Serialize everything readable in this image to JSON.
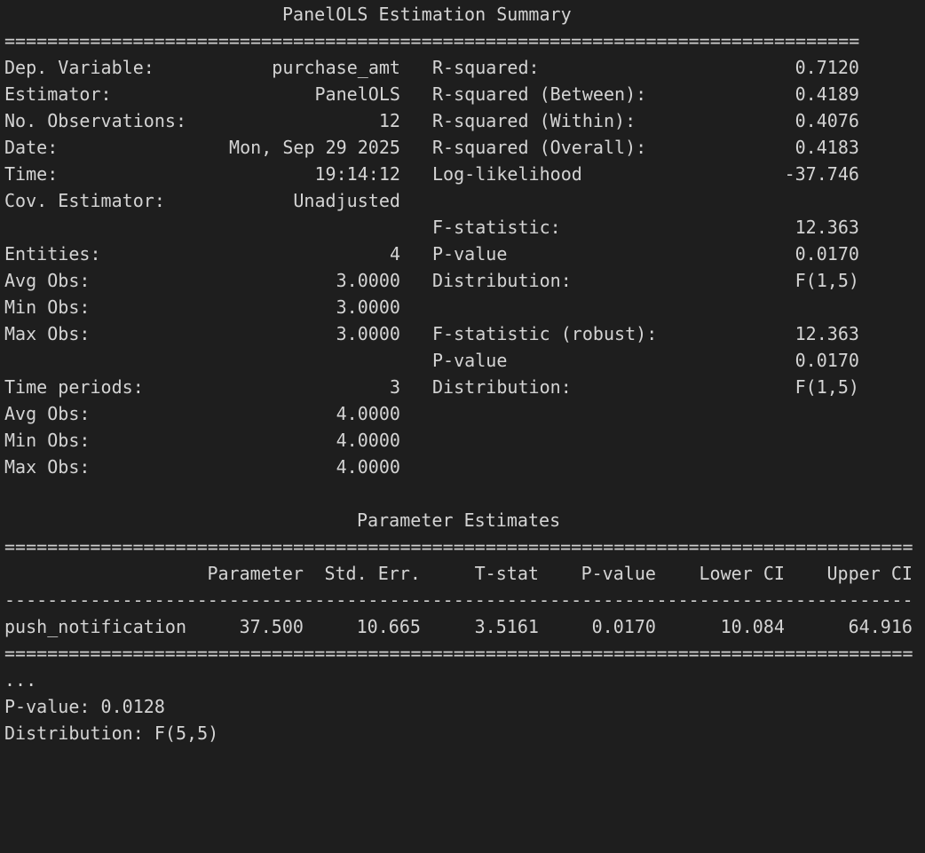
{
  "summary": {
    "title": "PanelOLS Estimation Summary",
    "rule": "==========================================================================================",
    "left": [
      {
        "label": "Dep. Variable:",
        "value": "purchase_amt"
      },
      {
        "label": "Estimator:",
        "value": "PanelOLS"
      },
      {
        "label": "No. Observations:",
        "value": "12"
      },
      {
        "label": "Date:",
        "value": "Mon, Sep 29 2025"
      },
      {
        "label": "Time:",
        "value": "19:14:12"
      },
      {
        "label": "Cov. Estimator:",
        "value": "Unadjusted"
      },
      {
        "label": "",
        "value": ""
      },
      {
        "label": "Entities:",
        "value": "4"
      },
      {
        "label": "Avg Obs:",
        "value": "3.0000"
      },
      {
        "label": "Min Obs:",
        "value": "3.0000"
      },
      {
        "label": "Max Obs:",
        "value": "3.0000"
      },
      {
        "label": "",
        "value": ""
      },
      {
        "label": "Time periods:",
        "value": "3"
      },
      {
        "label": "Avg Obs:",
        "value": "4.0000"
      },
      {
        "label": "Min Obs:",
        "value": "4.0000"
      },
      {
        "label": "Max Obs:",
        "value": "4.0000"
      }
    ],
    "right": [
      {
        "label": "R-squared:",
        "value": "0.7120"
      },
      {
        "label": "R-squared (Between):",
        "value": "0.4189"
      },
      {
        "label": "R-squared (Within):",
        "value": "0.4076"
      },
      {
        "label": "R-squared (Overall):",
        "value": "0.4183"
      },
      {
        "label": "Log-likelihood",
        "value": "-37.746"
      },
      {
        "label": "",
        "value": ""
      },
      {
        "label": "F-statistic:",
        "value": "12.363"
      },
      {
        "label": "P-value",
        "value": "0.0170"
      },
      {
        "label": "Distribution:",
        "value": "F(1,5)"
      },
      {
        "label": "",
        "value": ""
      },
      {
        "label": "F-statistic (robust):",
        "value": "12.363"
      },
      {
        "label": "P-value",
        "value": "0.0170"
      },
      {
        "label": "Distribution:",
        "value": "F(1,5)"
      }
    ]
  },
  "params": {
    "title": "Parameter Estimates",
    "rule_double": "==========================================================================================================",
    "rule_single": "----------------------------------------------------------------------------------------------------------",
    "headers": [
      "Parameter",
      "Std. Err.",
      "T-stat",
      "P-value",
      "Lower CI",
      "Upper CI"
    ],
    "rows": [
      {
        "name": "push_notification",
        "values": [
          "37.500",
          "10.665",
          "3.5161",
          "0.0170",
          "10.084",
          "64.916"
        ]
      }
    ]
  },
  "footer": {
    "ellipsis": "...",
    "pvalue": "P-value: 0.0128",
    "distribution": "Distribution: F(5,5)"
  }
}
